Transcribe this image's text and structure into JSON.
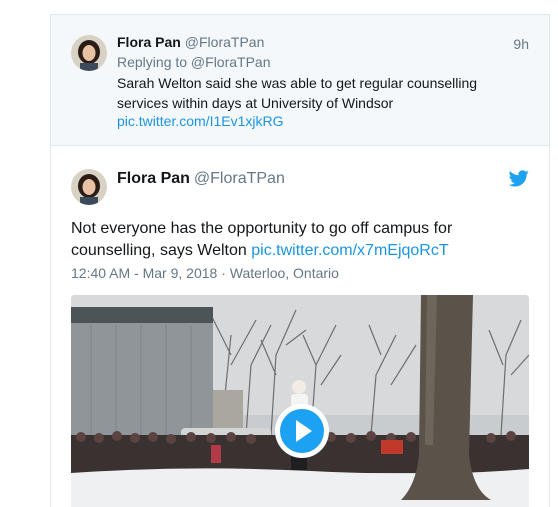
{
  "reply_tweet": {
    "author_name": "Flora Pan",
    "author_handle": "@FloraTPan",
    "time": "9h",
    "replying_to": "Replying to @FloraTPan",
    "text": "Sarah Welton said she was able to get regular counselling services within days at University of Windsor",
    "link": "pic.twitter.com/I1Ev1xjkRG"
  },
  "main_tweet": {
    "author_name": "Flora Pan",
    "author_handle": "@FloraTPan",
    "text": "Not everyone has the opportunity to go off campus for counselling, says Welton",
    "link": "pic.twitter.com/x7mEjqoRcT",
    "timestamp": "12:40 AM - Mar 9, 2018",
    "location_separator": " · ",
    "location": "Waterloo, Ontario",
    "media_type": "video"
  },
  "colors": {
    "accent": "#1da1f2",
    "link": "#1b95e0",
    "muted": "#657786",
    "text": "#14171a",
    "reply_bg": "#f5f8fa",
    "border": "#e1e8ed"
  },
  "icons": {
    "brand": "twitter-bird-icon",
    "play": "play-icon"
  }
}
